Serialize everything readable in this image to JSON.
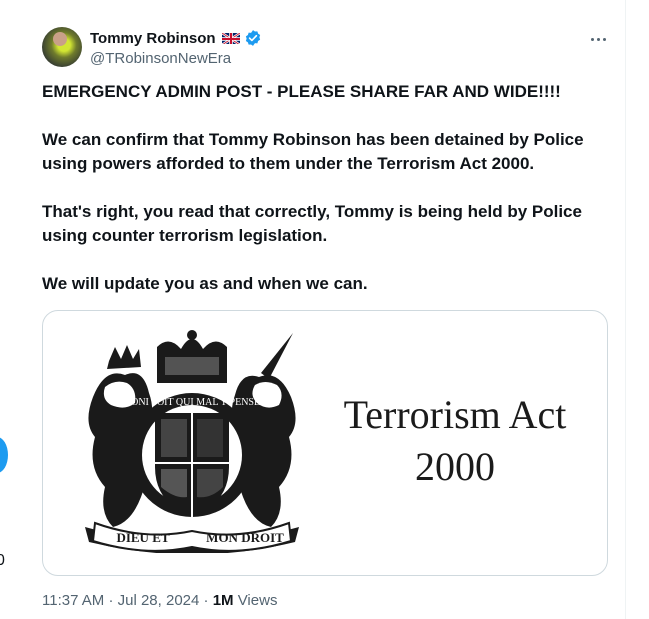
{
  "author": {
    "display_name": "Tommy Robinson",
    "handle": "@TRobinsonNewEra",
    "flag": "uk-flag-icon",
    "verified": "verified-badge-icon"
  },
  "tweet": {
    "paragraphs": [
      "EMERGENCY ADMIN POST - PLEASE SHARE FAR AND WIDE!!!!",
      "We can confirm that Tommy Robinson has been detained by Police using powers afforded to them under the Terrorism Act 2000.",
      "That's right, you read that correctly, Tommy is being held by Police using counter terrorism legislation.",
      "We will update you as and when we can."
    ]
  },
  "media": {
    "title_line1": "Terrorism Act",
    "title_line2": "2000",
    "crest_motto_left": "DIEU ET",
    "crest_motto_right": "MON DROIT",
    "crest_garter": "HONI SOIT QUI MAL Y PENSE"
  },
  "meta": {
    "time": "11:37 AM",
    "separator": "·",
    "date": "Jul 28, 2024",
    "views_count": "1M",
    "views_label": "Views"
  },
  "colors": {
    "text": "#0f1419",
    "secondary": "#536471",
    "border": "#cfd9de",
    "accent": "#1d9bf0"
  },
  "left_edge_digit": "0"
}
